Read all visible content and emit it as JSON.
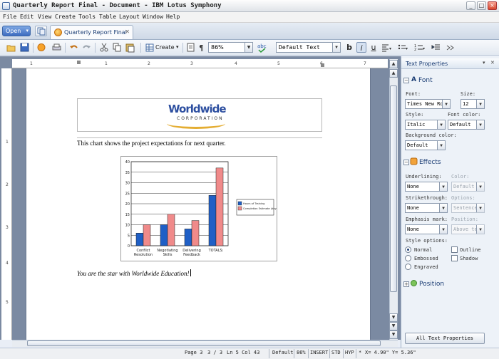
{
  "window": {
    "title": "Quarterly Report Final - Document - IBM Lotus Symphony"
  },
  "menu": [
    "File",
    "Edit",
    "View",
    "Create",
    "Tools",
    "Table",
    "Layout",
    "Window",
    "Help"
  ],
  "tabs": {
    "open_label": "Open",
    "doc_tab_label": "Quarterly Report Final"
  },
  "toolbar": {
    "create_label": "Create",
    "zoom": "86%",
    "para_style": "Default Text"
  },
  "document": {
    "logo_text": "Worldwide",
    "logo_subtext": "CORPORATION",
    "intro_text": "This chart shows the project expectations for next quarter.",
    "closing_text": "You are the star with Worldwide Education!"
  },
  "chart_data": {
    "type": "bar",
    "title": "",
    "categories": [
      "Conflict Resolution",
      "Negotiating Skills",
      "Delivering Feedback",
      "TOTALS:"
    ],
    "category_lines": [
      [
        "Conflict",
        "Resolution"
      ],
      [
        "Negotiating",
        "Skills"
      ],
      [
        "Delivering",
        "Feedback"
      ],
      [
        "TOTALS:"
      ]
    ],
    "series": [
      {
        "name": "Hours of Training",
        "color": "#1f5fc6",
        "values": [
          6,
          10,
          8,
          24
        ]
      },
      {
        "name": "Completion Estimate (days)",
        "color": "#f08a8a",
        "values": [
          10,
          15,
          12,
          37
        ]
      }
    ],
    "ylim": [
      0,
      40
    ],
    "yticks": [
      0,
      5,
      10,
      15,
      20,
      25,
      30,
      35,
      40
    ],
    "grid": true,
    "legend": "right"
  },
  "ruler": {
    "h_numbers": [
      "1",
      "1",
      "2",
      "3",
      "4",
      "5",
      "6",
      "7"
    ],
    "v_numbers": [
      "1",
      "2",
      "3",
      "4",
      "5"
    ]
  },
  "panel": {
    "title": "Text Properties",
    "font_section": "Font",
    "font_label": "Font:",
    "font_value": "Times New Roman",
    "size_label": "Size:",
    "size_value": "12",
    "style_label": "Style:",
    "style_value": "Italic",
    "font_color_label": "Font color:",
    "font_color_value": "Default",
    "bg_color_label": "Background color:",
    "bg_color_value": "Default",
    "effects_section": "Effects",
    "underlining_label": "Underlining:",
    "underlining_value": "None",
    "color_label": "Color:",
    "color_value": "Default",
    "strike_label": "Strikethrough:",
    "strike_value": "None",
    "options_label": "Options:",
    "options_value": "Sentence",
    "emphasis_label": "Emphasis mark:",
    "emphasis_value": "None",
    "position_label": "Position:",
    "position_value": "Above text",
    "style_options_label": "Style options:",
    "normal": "Normal",
    "embossed": "Embossed",
    "engraved": "Engraved",
    "outline": "Outline",
    "shadow": "Shadow",
    "position_section": "Position",
    "all_props_button": "All Text Properties"
  },
  "status": {
    "page": "Page 3",
    "pages": "3 / 3",
    "lncol": "Ln 5 Col 43",
    "style": "Default",
    "zoom": "86%",
    "insert": "INSERT",
    "std": "STD",
    "hyp": "HYP",
    "star": "*",
    "coords": "X= 4.90\"  Y= 5.36\""
  },
  "colors": {
    "accent": "#1b3d74",
    "workspace": "#7b8aa2"
  }
}
